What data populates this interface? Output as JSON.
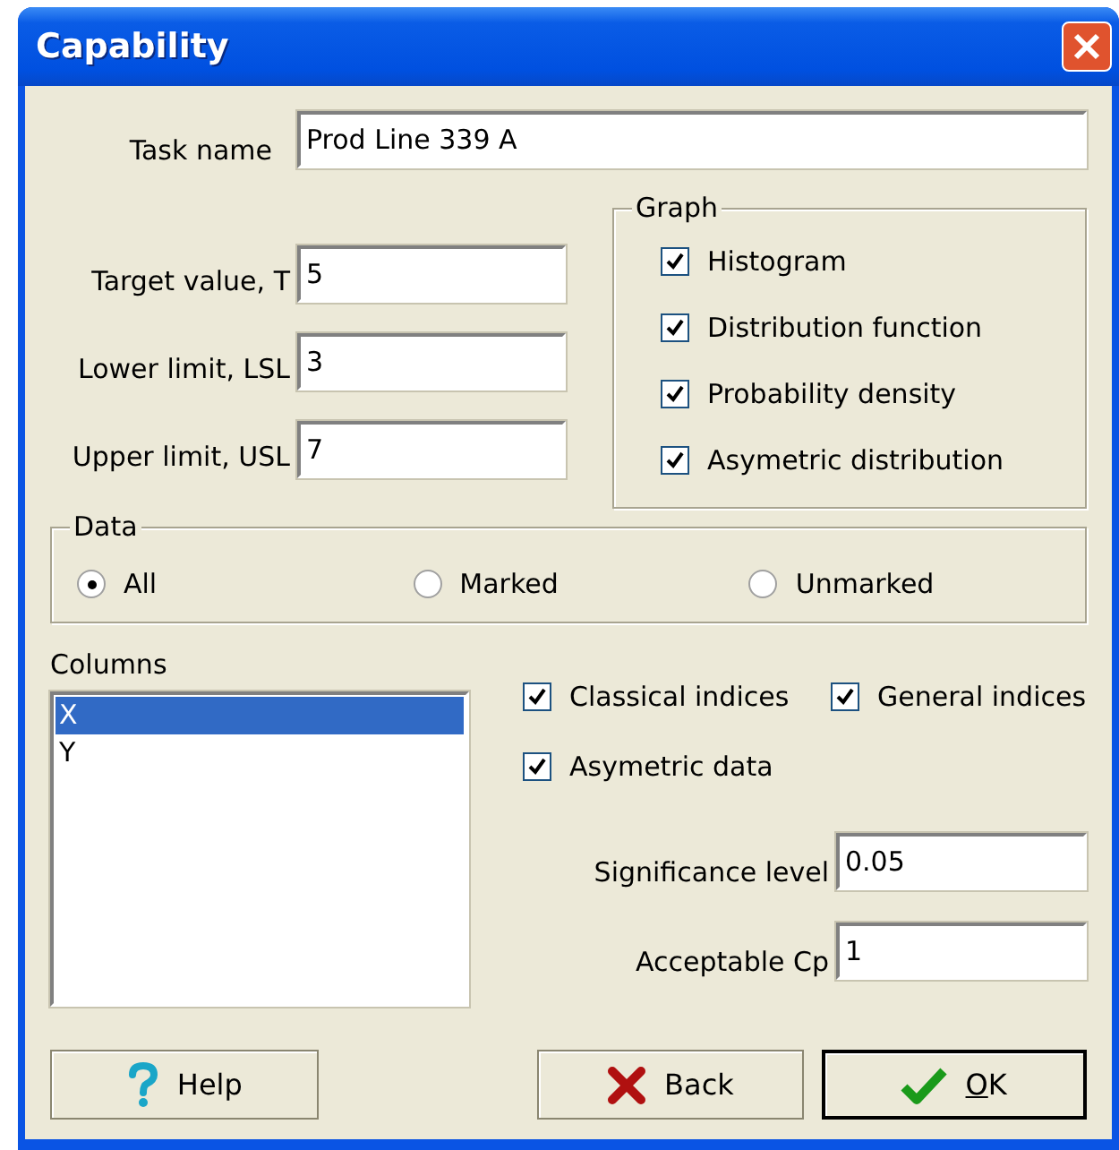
{
  "window": {
    "title": "Capability"
  },
  "task_name": {
    "label": "Task name",
    "value": "Prod Line 339 A"
  },
  "limits": [
    {
      "label": "Target value, T",
      "value": "5"
    },
    {
      "label": "Lower limit, LSL",
      "value": "3"
    },
    {
      "label": "Upper limit, USL",
      "value": "7"
    }
  ],
  "graph": {
    "title": "Graph",
    "options": [
      {
        "label": "Histogram",
        "checked": true
      },
      {
        "label": "Distribution function",
        "checked": true
      },
      {
        "label": "Probability density",
        "checked": true
      },
      {
        "label": "Asymetric distribution",
        "checked": true
      }
    ]
  },
  "data": {
    "title": "Data",
    "options": [
      {
        "label": "All",
        "selected": true
      },
      {
        "label": "Marked",
        "selected": false
      },
      {
        "label": "Unmarked",
        "selected": false
      }
    ]
  },
  "columns": {
    "label": "Columns",
    "items": [
      {
        "label": "X",
        "selected": true
      },
      {
        "label": "Y",
        "selected": false
      }
    ]
  },
  "indices": [
    {
      "label": "Classical indices",
      "checked": true
    },
    {
      "label": "General indices",
      "checked": true
    },
    {
      "label": "Asymetric data",
      "checked": true
    }
  ],
  "parameters": [
    {
      "label": "Significance level",
      "value": "0.05"
    },
    {
      "label": "Acceptable Cp",
      "value": "1"
    }
  ],
  "buttons": [
    {
      "kind": "help",
      "label": "Help"
    },
    {
      "kind": "back",
      "label": "Back"
    },
    {
      "kind": "ok",
      "label": "OK"
    }
  ]
}
